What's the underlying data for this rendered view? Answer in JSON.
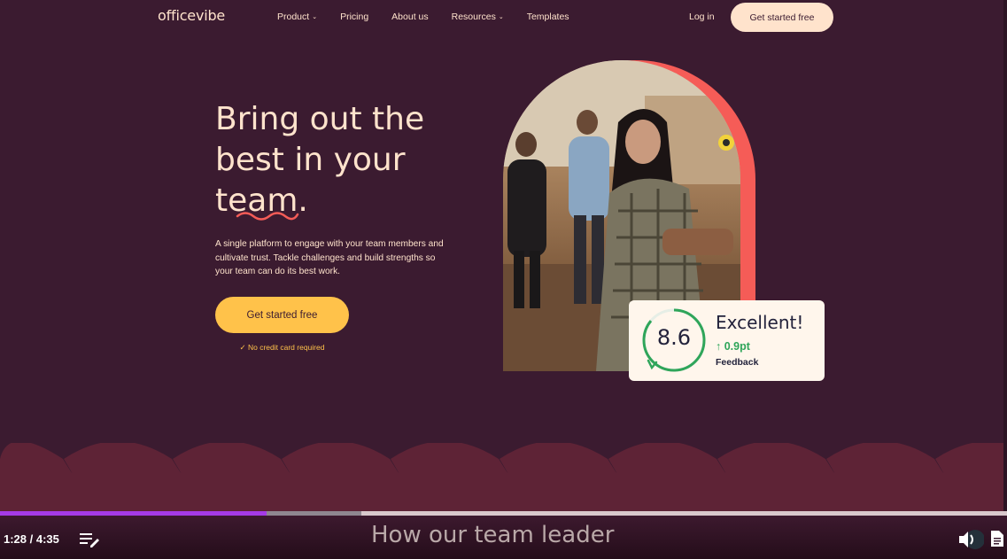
{
  "nav": {
    "logo": "officevibe",
    "items": [
      {
        "label": "Product",
        "dropdown": true
      },
      {
        "label": "Pricing",
        "dropdown": false
      },
      {
        "label": "About us",
        "dropdown": false
      },
      {
        "label": "Resources",
        "dropdown": true
      },
      {
        "label": "Templates",
        "dropdown": false
      }
    ],
    "login": "Log in",
    "cta": "Get started free"
  },
  "hero": {
    "headline": [
      "Bring out the",
      "best in your",
      "team."
    ],
    "subtext": "A single platform to engage with your team members and cultivate trust. Tackle challenges and build strengths so your team can do its best work.",
    "cta": "Get started free",
    "note": "✓ No credit card required"
  },
  "score_card": {
    "score": "8.6",
    "score_progress": 0.86,
    "rating": "Excellent!",
    "delta": "↑ 0.9pt",
    "label": "Feedback"
  },
  "video": {
    "time": "1:28 / 4:35",
    "played_fraction": 0.265,
    "buffered_fraction": 0.359,
    "caption": "How our team leader"
  },
  "colors": {
    "background": "#3b1b30",
    "cream": "#ffe3cc",
    "yellow": "#ffc24a",
    "coral": "#f55c57",
    "wave": "#5e2336",
    "progress": "#a63ae6",
    "green": "#2fa55a"
  },
  "icons": {
    "chevron": "chevron-down-icon",
    "playlist": "playlist-edit-icon",
    "volume": "volume-icon",
    "transcript": "document-icon"
  }
}
